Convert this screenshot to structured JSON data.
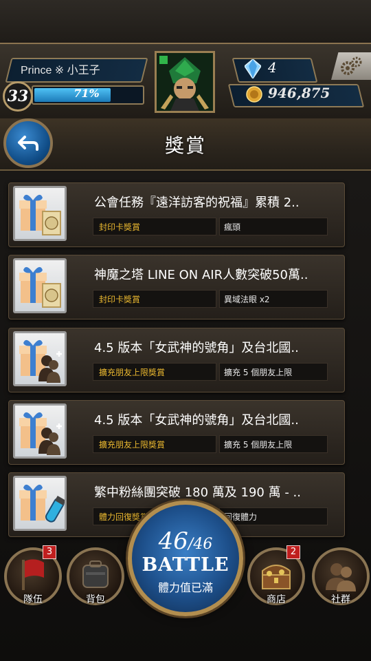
{
  "player": {
    "name": "Prince ※ 小王子",
    "level": "33",
    "exp_percent": "71%",
    "exp_fraction": 0.71,
    "gems": "4",
    "coins": "946,875"
  },
  "header": {
    "title": "獎賞"
  },
  "rewards": [
    {
      "title": "公會任務『遠洋訪客的祝福』累積 2..",
      "tag": "封印卡獎賞",
      "item": "瘋頭"
    },
    {
      "title": "神魔之塔 LINE ON AIR人數突破50萬..",
      "tag": "封印卡獎賞",
      "item": "異域法眼 x2"
    },
    {
      "title": "4.5 版本「女武神的號角」及台北國..",
      "tag": "擴充朋友上限獎賞",
      "item": "擴充 5 個朋友上限"
    },
    {
      "title": "4.5 版本「女武神的號角」及台北國..",
      "tag": "擴充朋友上限獎賞",
      "item": "擴充 5 個朋友上限"
    },
    {
      "title": "繁中粉絲團突破 180 萬及 190 萬 - ..",
      "tag": "體力回復獎賞",
      "item": "回復體力"
    }
  ],
  "battle": {
    "stamina": "46",
    "stamina_max": "/46",
    "label": "BATTLE",
    "status": "體力值已滿"
  },
  "nav": {
    "team": {
      "label": "隊伍",
      "badge": "3"
    },
    "bag": {
      "label": "背包"
    },
    "shop": {
      "label": "商店",
      "badge": "2"
    },
    "social": {
      "label": "社群"
    }
  },
  "icons": {
    "back": "back-arrow-icon",
    "settings": "gear-icon",
    "gem": "diamond-icon",
    "coin": "coin-icon"
  },
  "colors": {
    "tag_gold": "#e9b72f",
    "exp_blue": "#4fc2f5",
    "badge_red": "#c01f1f"
  }
}
